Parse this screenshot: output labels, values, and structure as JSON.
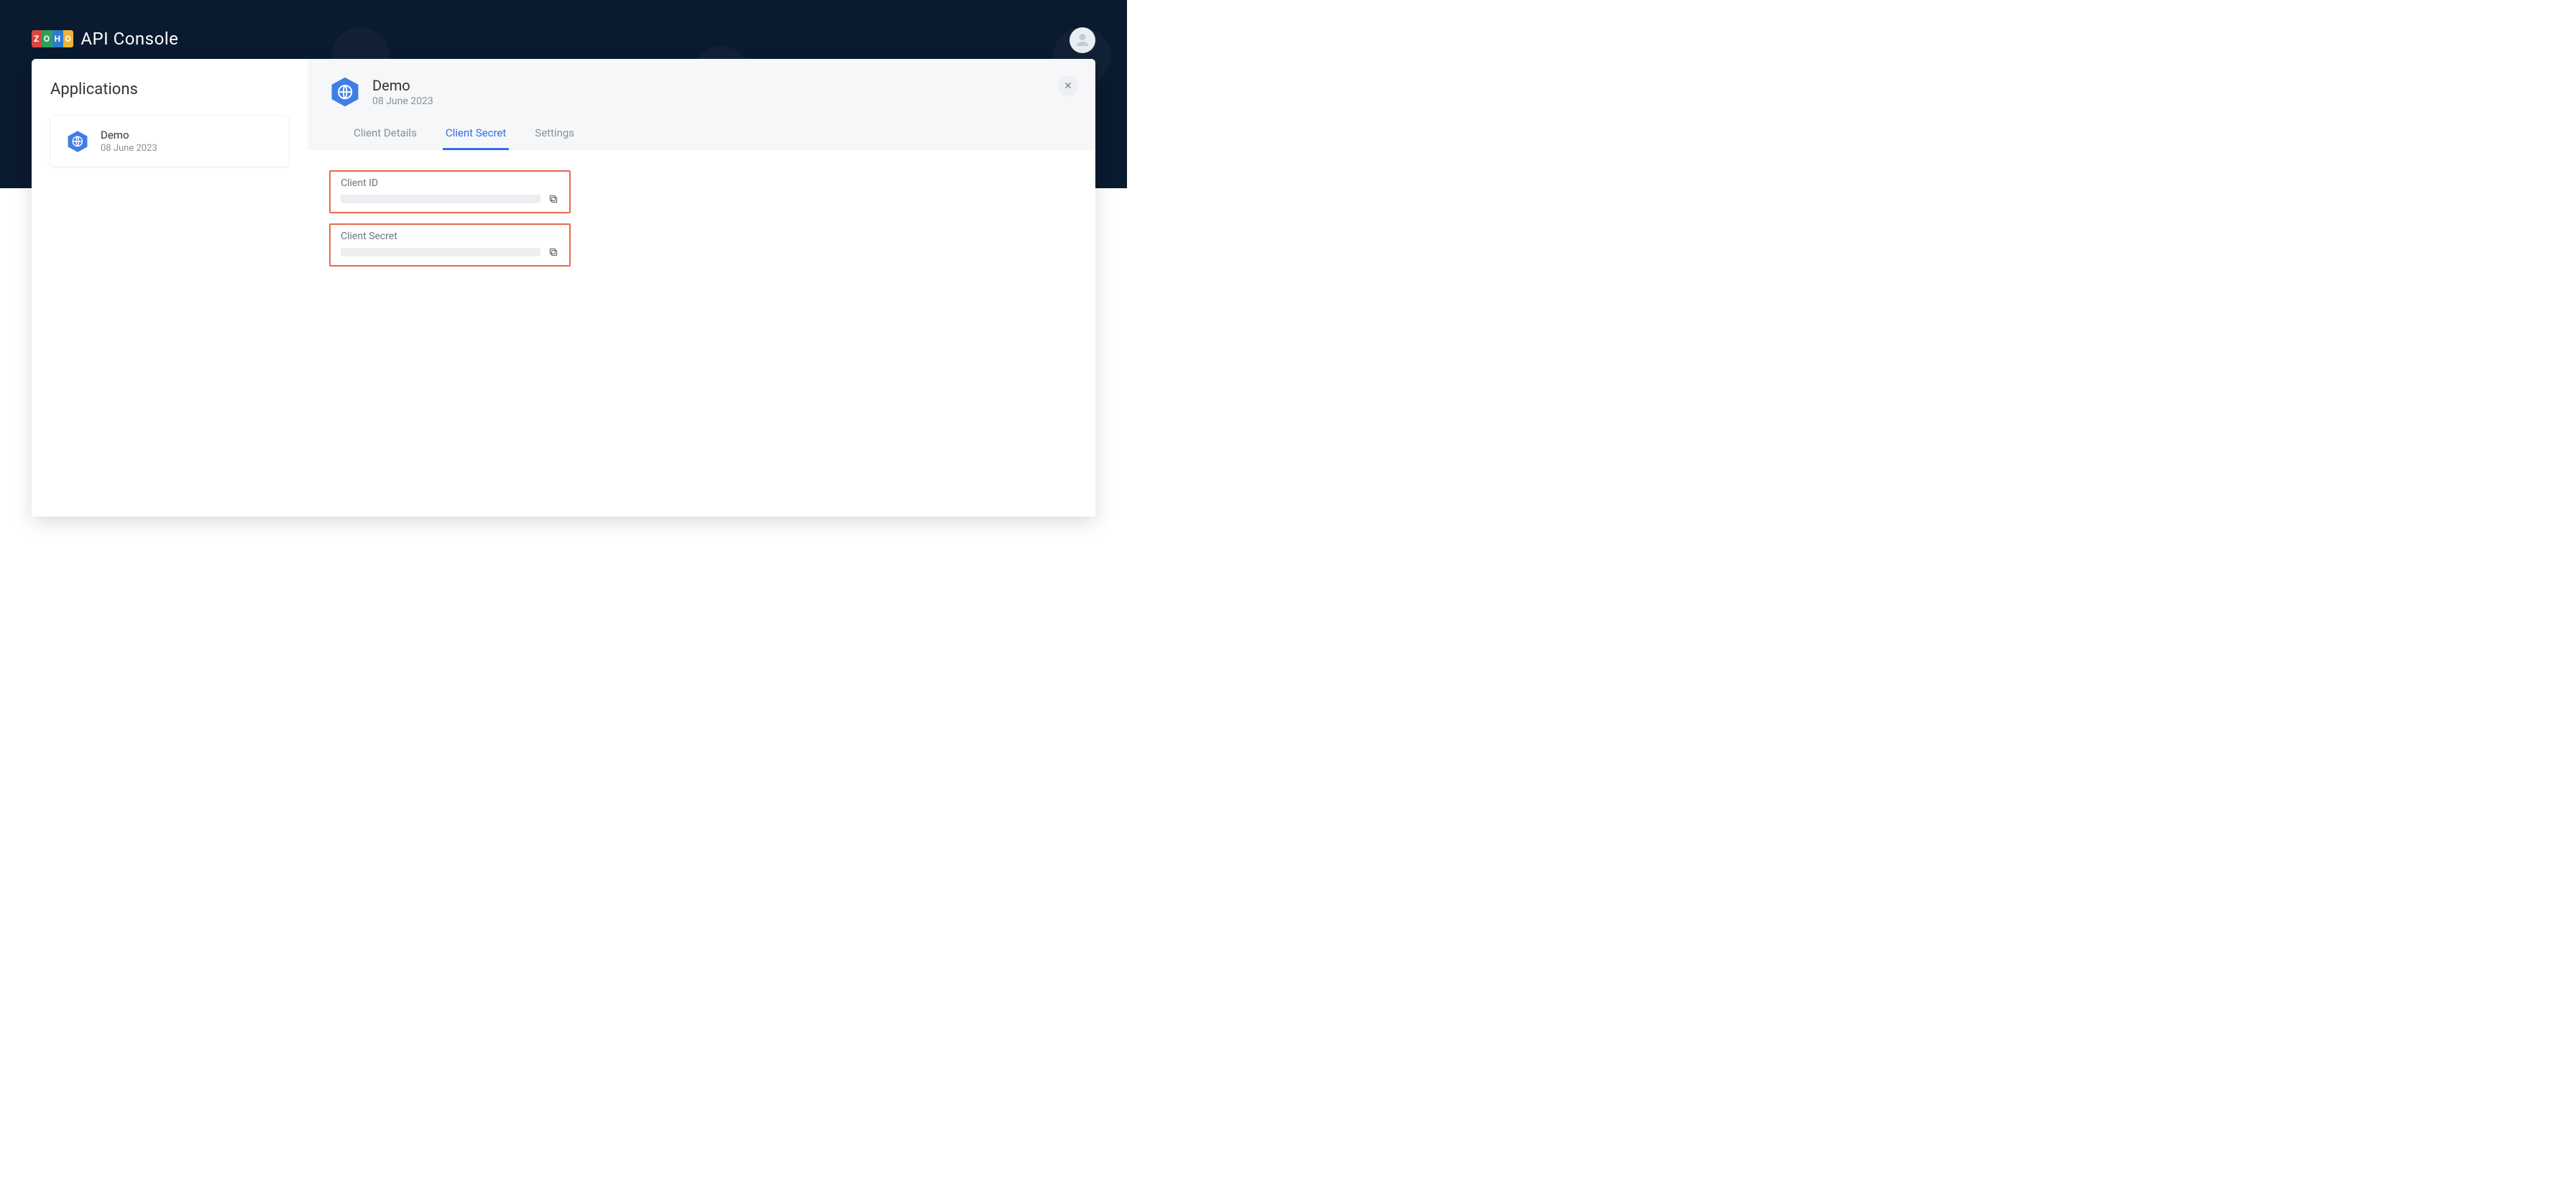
{
  "brand": {
    "name_parts": [
      "Z",
      "O",
      "H",
      "O"
    ],
    "title": "API Console"
  },
  "header": {
    "chip_text": ""
  },
  "sidebar": {
    "title": "Applications",
    "apps": [
      {
        "name": "Demo",
        "date": "08 June 2023"
      }
    ]
  },
  "detail": {
    "icon": "globe-hex",
    "title": "Demo",
    "date": "08 June 2023",
    "tabs": [
      {
        "id": "client-details",
        "label": "Client Details",
        "active": false
      },
      {
        "id": "client-secret",
        "label": "Client Secret",
        "active": true
      },
      {
        "id": "settings",
        "label": "Settings",
        "active": false
      }
    ],
    "fields": {
      "client_id": {
        "label": "Client ID",
        "value": ""
      },
      "client_secret": {
        "label": "Client Secret",
        "value": ""
      }
    }
  },
  "colors": {
    "accent": "#2f6fe4",
    "highlight_border": "#e46a4f",
    "hex_fill": "#3f7ee6"
  }
}
